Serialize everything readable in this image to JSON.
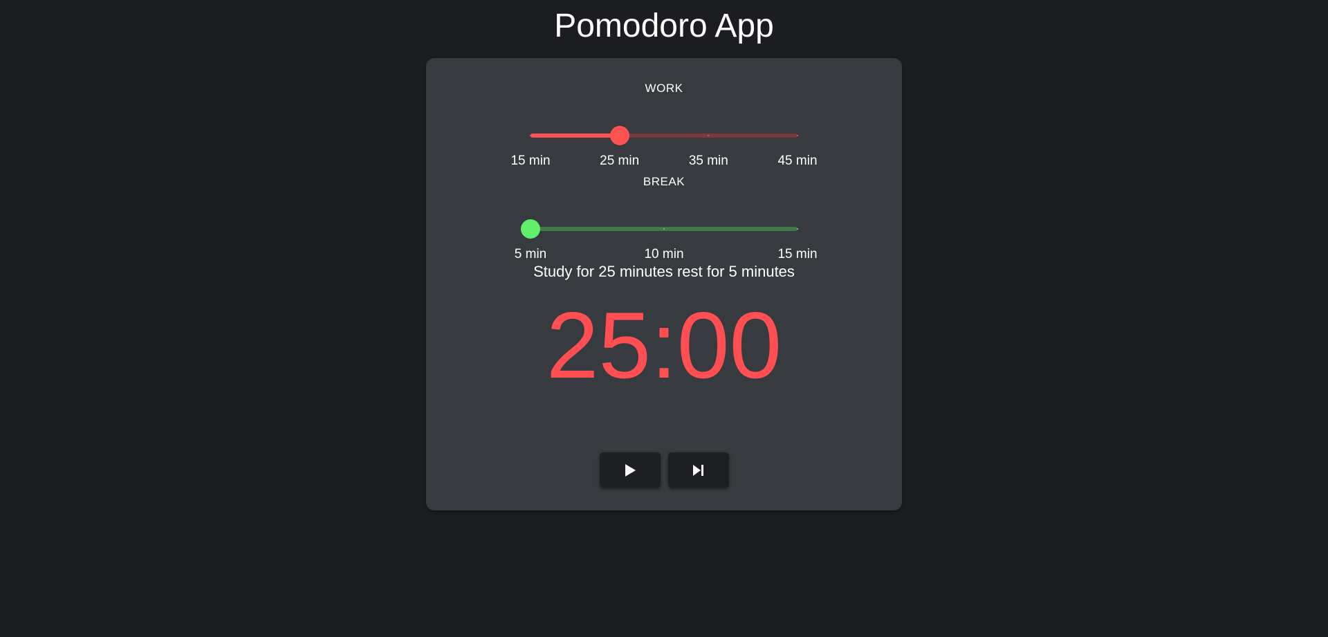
{
  "header": {
    "title": "Pomodoro App"
  },
  "work": {
    "label": "WORK",
    "marks": [
      "15 min",
      "25 min",
      "35 min",
      "45 min"
    ],
    "selected_index": 1,
    "value_fraction": 0.3333,
    "color": "#ff5252",
    "track_color": "#7a3a3d"
  },
  "break": {
    "label": "BREAK",
    "marks": [
      "5 min",
      "10 min",
      "15 min"
    ],
    "selected_index": 0,
    "value_fraction": 0,
    "color": "#5fef6a",
    "track_color": "#3f7a46"
  },
  "summary": "Study for 25 minutes rest for 5 minutes",
  "timer": {
    "display": "25:00",
    "color": "#ff4f52"
  },
  "controls": {
    "play_icon": "play-icon",
    "skip_icon": "skip-next-icon"
  }
}
